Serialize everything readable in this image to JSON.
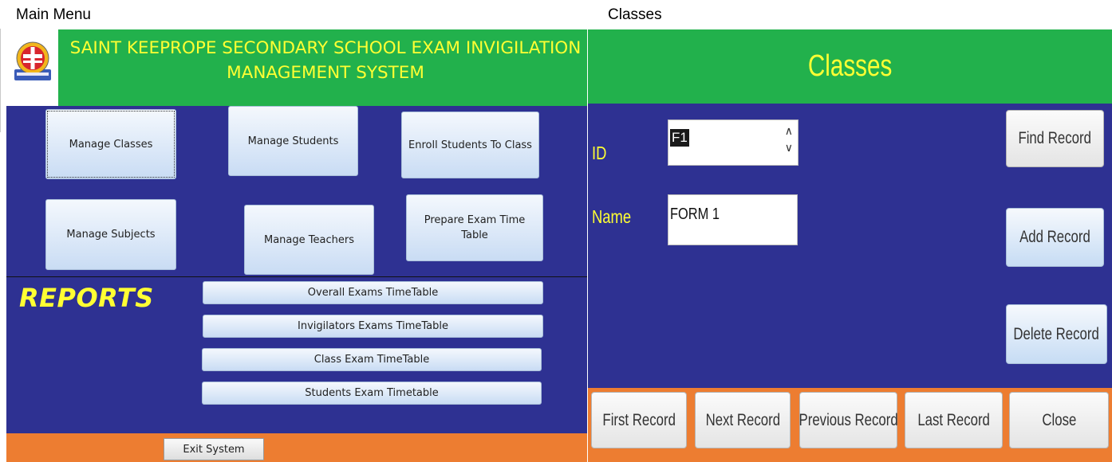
{
  "captions": {
    "main_menu": "Main Menu",
    "classes": "Classes"
  },
  "colors": {
    "panel_blue": "#2e3192",
    "header_green": "#22b14c",
    "title_yellow": "#ffff33",
    "footer_orange": "#ed7d31",
    "button_blue": "#c9dcf4"
  },
  "main_menu": {
    "logo_icon": "school-crest-icon",
    "title": "SAINT KEEPROPE SECONDARY SCHOOL EXAM INVIGILATION MANAGEMENT SYSTEM",
    "buttons": [
      {
        "label": "Manage Classes",
        "focused": true
      },
      {
        "label": "Manage Students"
      },
      {
        "label": "Enroll Students To Class"
      },
      {
        "label": "Manage Subjects"
      },
      {
        "label": "Manage Teachers"
      },
      {
        "label": "Prepare Exam Time Table"
      }
    ],
    "reports_heading": "REPORTS",
    "reports": [
      "Overall Exams TimeTable",
      "Invigilators Exams TimeTable",
      "Class Exam TimeTable",
      "Students Exam Timetable"
    ],
    "exit_label": "Exit System"
  },
  "classes_form": {
    "title": "Classes",
    "id_label": "ID",
    "id_value": "F1",
    "name_label": "Name",
    "name_value": "FORM 1",
    "side_buttons": [
      "Find Record",
      "Add Record",
      "Delete Record"
    ],
    "nav_buttons": [
      "First Record",
      "Next Record",
      "Previous Record",
      "Last Record",
      "Close"
    ]
  }
}
